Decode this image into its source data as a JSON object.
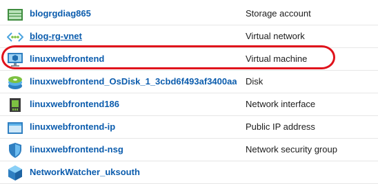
{
  "resources": [
    {
      "name": "blogrgdiag865",
      "type": "Storage account",
      "icon": "storage-account-icon",
      "underlined": false
    },
    {
      "name": "blog-rg-vnet",
      "type": "Virtual network",
      "icon": "virtual-network-icon",
      "underlined": true
    },
    {
      "name": "linuxwebfrontend",
      "type": "Virtual machine",
      "icon": "virtual-machine-icon",
      "underlined": false
    },
    {
      "name": "linuxwebfrontend_OsDisk_1_3cbd6f493af3400aa…",
      "type": "Disk",
      "icon": "disk-icon",
      "underlined": false
    },
    {
      "name": "linuxwebfrontend186",
      "type": "Network interface",
      "icon": "network-interface-icon",
      "underlined": false
    },
    {
      "name": "linuxwebfrontend-ip",
      "type": "Public IP address",
      "icon": "public-ip-icon",
      "underlined": false
    },
    {
      "name": "linuxwebfrontend-nsg",
      "type": "Network security group",
      "icon": "network-security-group-icon",
      "underlined": false
    },
    {
      "name": "NetworkWatcher_uksouth",
      "type": "",
      "icon": "network-watcher-icon",
      "underlined": false
    }
  ],
  "highlight_color": "#e0121b",
  "link_color": "#0b5cad"
}
